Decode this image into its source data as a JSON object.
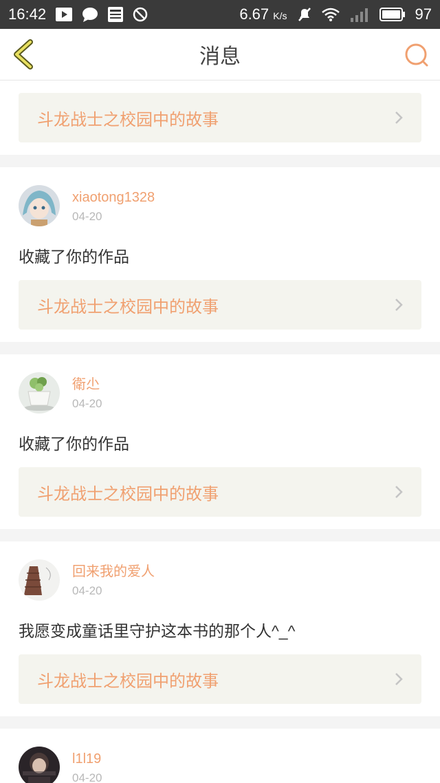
{
  "status_bar": {
    "time": "16:42",
    "network_speed": "6.67",
    "network_unit": "K/s",
    "battery": "97",
    "icons": [
      "play-icon",
      "chat-icon",
      "news-icon",
      "do-not-disturb-icon",
      "mute-icon",
      "wifi-icon",
      "signal-icon",
      "battery-icon"
    ]
  },
  "header": {
    "title": "消息",
    "back_icon": "chevron-left-icon",
    "search_icon": "search-icon",
    "accent_color": "#f0a070"
  },
  "top_book_link": {
    "title": "斗龙战士之校园中的故事"
  },
  "messages": [
    {
      "username": "xiaotong1328",
      "date": "04-20",
      "text": "收藏了你的作品",
      "book_title": "斗龙战士之校园中的故事"
    },
    {
      "username": "衛尐",
      "date": "04-20",
      "text": "收藏了你的作品",
      "book_title": "斗龙战士之校园中的故事"
    },
    {
      "username": "回来我的爱人",
      "date": "04-20",
      "text": "我愿变成童话里守护这本书的那个人^_^",
      "book_title": "斗龙战士之校园中的故事"
    },
    {
      "username": "l1l19",
      "date": "04-20"
    }
  ]
}
